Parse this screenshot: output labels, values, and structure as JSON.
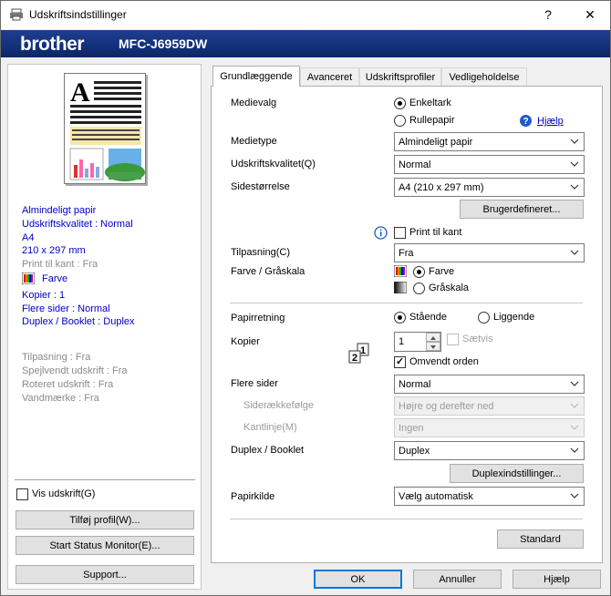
{
  "window": {
    "title": "Udskriftsindstillinger",
    "help_btn": "?",
    "close_btn": "✕"
  },
  "brand": {
    "logo": "brother",
    "model": "MFC-J6959DW"
  },
  "summary": {
    "media": "Almindeligt papir",
    "quality": "Udskriftskvalitet : Normal",
    "size": "A4",
    "dimensions": "210 x 297 mm",
    "borderless": "Print til kant : Fra",
    "color": "Farve",
    "copies": "Kopier : 1",
    "multipage": "Flere sider : Normal",
    "duplex": "Duplex / Booklet : Duplex",
    "fit": "Tilpasning : Fra",
    "mirror": "Spejlvendt udskrift : Fra",
    "rotate": "Roteret udskrift : Fra",
    "watermark": "Vandmærke : Fra"
  },
  "left_buttons": {
    "show_print": "Vis udskrift(G)",
    "add_profile": "Tilføj profil(W)...",
    "status_monitor": "Start Status Monitor(E)...",
    "support": "Support..."
  },
  "tabs": [
    "Grundlæggende",
    "Avanceret",
    "Udskriftsprofiler",
    "Vedligeholdelse"
  ],
  "basic": {
    "media_select_label": "Medievalg",
    "sheet": "Enkeltark",
    "roll": "Rullepapir",
    "help": "Hjælp",
    "media_type_label": "Medietype",
    "media_type_value": "Almindeligt papir",
    "quality_label": "Udskriftskvalitet(Q)",
    "quality_value": "Normal",
    "page_size_label": "Sidestørrelse",
    "page_size_value": "A4 (210 x 297 mm)",
    "custom_btn": "Brugerdefineret...",
    "borderless_label": "Print til kant",
    "fit_label": "Tilpasning(C)",
    "fit_value": "Fra",
    "color_label": "Farve / Gråskala",
    "color_opt": "Farve",
    "gray_opt": "Gråskala",
    "orientation_label": "Papirretning",
    "portrait": "Stående",
    "landscape": "Liggende",
    "copies_label": "Kopier",
    "copies_value": "1",
    "collate": "Sætvis",
    "reverse": "Omvendt orden",
    "multipage_label": "Flere sider",
    "multipage_value": "Normal",
    "page_order_label": "Siderækkefølge",
    "page_order_value": "Højre og derefter ned",
    "border_label": "Kantlinje(M)",
    "border_value": "Ingen",
    "duplex_label": "Duplex / Booklet",
    "duplex_value": "Duplex",
    "duplex_settings_btn": "Duplexindstillinger...",
    "source_label": "Papirkilde",
    "source_value": "Vælg automatisk",
    "default_btn": "Standard"
  },
  "footer": {
    "ok": "OK",
    "cancel": "Annuller",
    "help": "Hjælp"
  }
}
